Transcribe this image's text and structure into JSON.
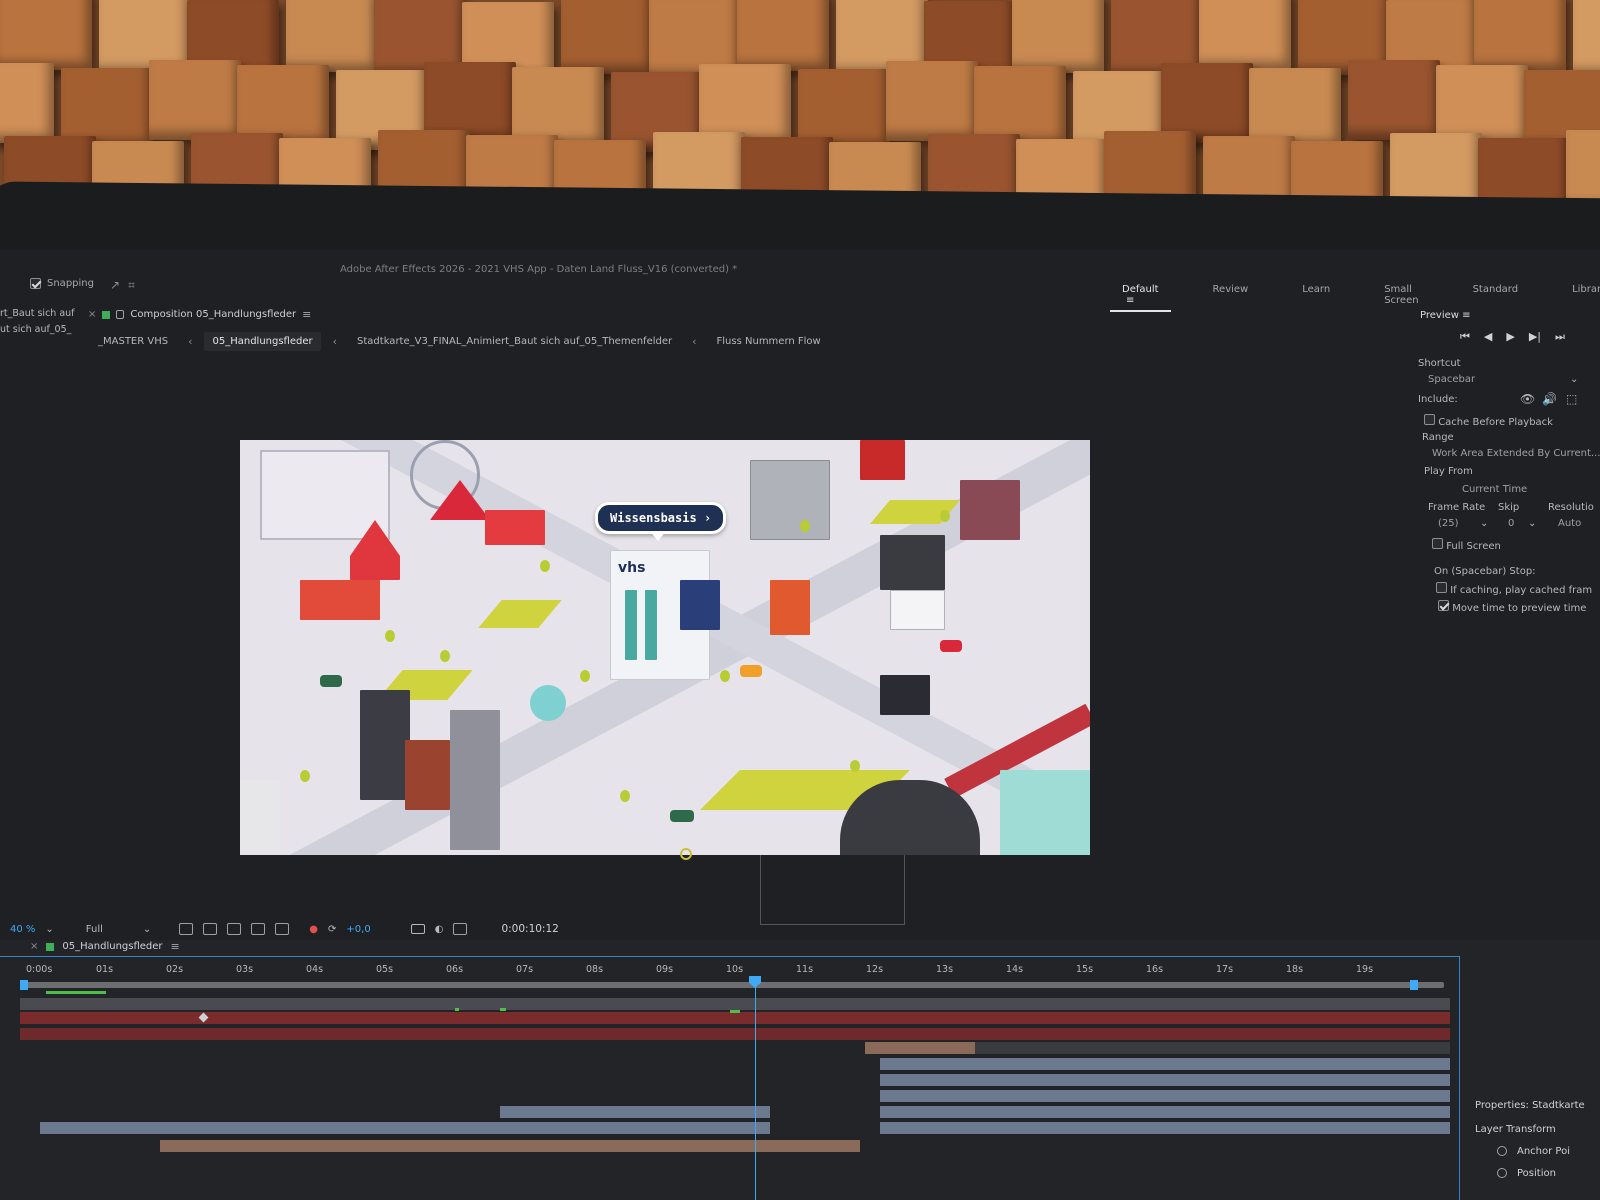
{
  "window": {
    "title": "Adobe After Effects 2026 - 2021 VHS App - Daten Land Fluss_V16 (converted) *"
  },
  "toolbar": {
    "snapping_label": "Snapping"
  },
  "workspaces": [
    {
      "label": "Default",
      "active": true
    },
    {
      "label": "Review",
      "active": false
    },
    {
      "label": "Learn",
      "active": false
    },
    {
      "label": "Small Screen",
      "active": false
    },
    {
      "label": "Standard",
      "active": false
    },
    {
      "label": "Libraries",
      "active": false
    }
  ],
  "left_panel": {
    "line1": "rt_Baut sich auf",
    "line2": "ut sich auf_05_"
  },
  "composition_panel": {
    "title": "Composition 05_Handlungsfleder"
  },
  "breadcrumb": [
    {
      "label": "_MASTER VHS",
      "active": false
    },
    {
      "label": "05_Handlungsfleder",
      "active": true
    },
    {
      "label": "Stadtkarte_V3_FINAL_Animiert_Baut sich auf_05_Themenfelder",
      "active": false
    },
    {
      "label": "Fluss Nummern Flow",
      "active": false
    }
  ],
  "viewer": {
    "bubble_label": "Wissensbasis",
    "logo_text": "vhs"
  },
  "viewer_toolbar": {
    "zoom": "40 %",
    "resolution": "Full",
    "exposure": "+0,0",
    "timecode": "0:00:10:12"
  },
  "preview_panel": {
    "title": "Preview",
    "shortcut_label": "Shortcut",
    "shortcut_value": "Spacebar",
    "include_label": "Include:",
    "cache_before_playback": "Cache Before Playback",
    "range_label": "Range",
    "range_value": "Work Area Extended By Current...",
    "play_from_label": "Play From",
    "play_from_value": "Current Time",
    "frame_rate_label": "Frame Rate",
    "frame_rate_value": "(25)",
    "skip_label": "Skip",
    "skip_value": "0",
    "resolution_label": "Resolutio",
    "resolution_value": "Auto",
    "full_screen": "Full Screen",
    "on_stop_label": "On (Spacebar) Stop:",
    "if_caching": "If caching, play cached fram",
    "move_time": "Move time to preview time"
  },
  "timeline": {
    "tab_label": "05_Handlungsfleder",
    "ticks": [
      "0:00s",
      "01s",
      "02s",
      "03s",
      "04s",
      "05s",
      "06s",
      "07s",
      "08s",
      "09s",
      "10s",
      "11s",
      "12s",
      "13s",
      "14s",
      "15s",
      "16s",
      "17s",
      "18s",
      "19s"
    ]
  },
  "properties_panel": {
    "title": "Properties: Stadtkarte",
    "section": "Layer Transform",
    "anchor": "Anchor Poi",
    "position": "Position"
  },
  "colors": {
    "accent": "#3fa9f5",
    "panel_bg": "#1f2023",
    "red_layer": "#7a2b2b",
    "bubble_bg": "#1f3055"
  }
}
